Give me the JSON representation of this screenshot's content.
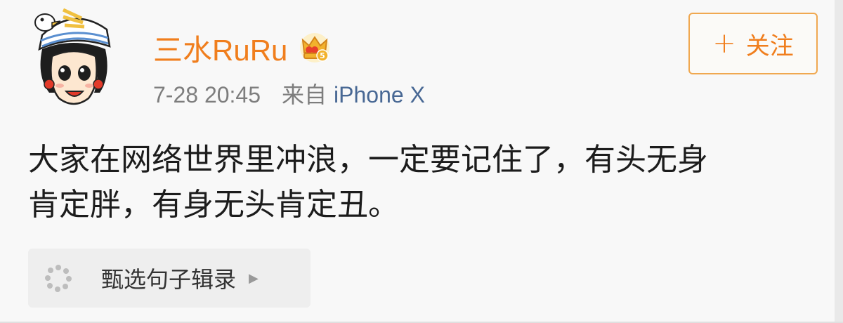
{
  "post": {
    "username": "三水RuRu",
    "time": "7-28 20:45",
    "source_label": "来自",
    "device": "iPhone X",
    "follow_label": "关注",
    "content_lines": [
      "大家在网络世界里冲浪，一定要记住了，有头无身",
      "肯定胖，有身无头肯定丑。"
    ],
    "topic_label": "甄选句子辑录"
  },
  "colors": {
    "username": "#f07e1d",
    "device_link": "#486894",
    "follow_border": "#f0a850",
    "meta_text": "#7d7d7d"
  },
  "icons": {
    "avatar": "cartoon-girl-avatar",
    "badge": "crown-vip-icon",
    "follow": "plus-icon",
    "topic": "pinwheel-dots-icon",
    "topic_arrow": "triangle-right-icon"
  }
}
